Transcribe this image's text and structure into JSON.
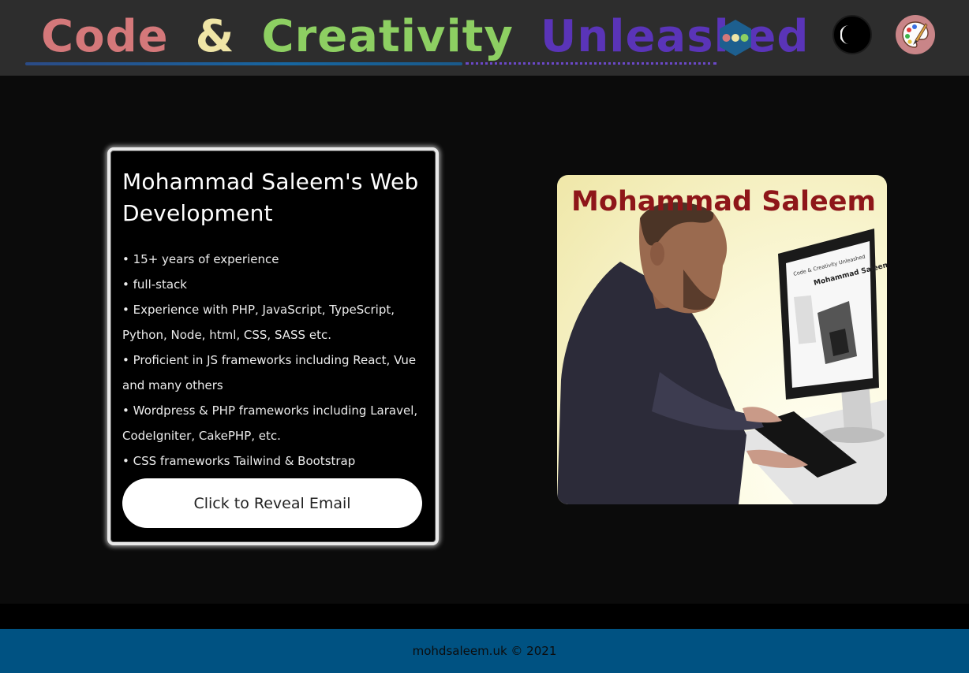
{
  "header": {
    "logo_words": [
      "Code",
      "&",
      "Creativity",
      "Unleashed"
    ],
    "icons": {
      "menu": "hexagon-dots-icon",
      "theme_toggle": "moon-icon",
      "theme_picker": "palette-icon"
    }
  },
  "card": {
    "title": "Mohammad Saleem's Web Development",
    "bullets": [
      "• 15+ years of experience",
      "• full-stack",
      "• Experience with PHP, JavaScript, TypeScript, Python, Node, html, CSS, SASS etc.",
      "• Proficient in JS frameworks including React, Vue and many others",
      "• Wordpress & PHP frameworks including Laravel, CodeIgniter, CakePHP, etc.",
      "• CSS frameworks Tailwind & Bootstrap"
    ],
    "button_label": "Click to Reveal Email"
  },
  "portrait": {
    "name": "Mohammad Saleem",
    "screen_title": "Mohammad Saleem",
    "screen_header": "Code & Creativity Unleashed"
  },
  "footer": {
    "text": "mohdsaleem.uk © 2021"
  },
  "colors": {
    "header_bg": "#2d2d2d",
    "page_bg": "#0b0b0b",
    "footer_bg": "#005282",
    "logo_code": "#d4787a",
    "logo_amp": "#efe5a6",
    "logo_creativity": "#8dcf62",
    "logo_unleashed": "#5a34b8",
    "portrait_name": "#8e1619"
  }
}
